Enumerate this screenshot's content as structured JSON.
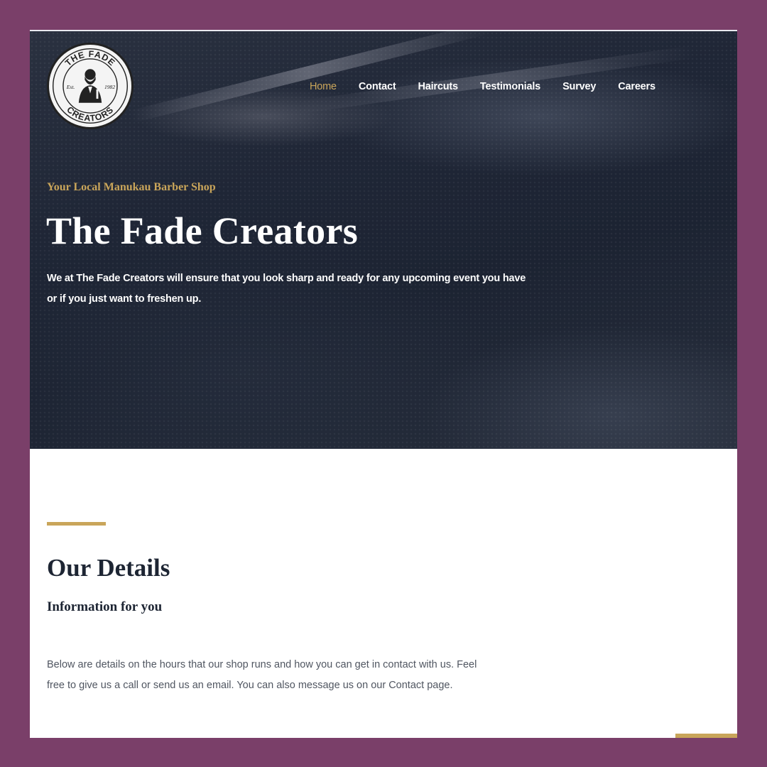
{
  "brand": {
    "logo_top_text": "THE FADE",
    "logo_bottom_text": "CREATORS",
    "logo_left_text": "Est.",
    "logo_right_text": "1982"
  },
  "nav": {
    "items": [
      {
        "label": "Home",
        "active": true
      },
      {
        "label": "Contact",
        "active": false
      },
      {
        "label": "Haircuts",
        "active": false
      },
      {
        "label": "Testimonials",
        "active": false
      },
      {
        "label": "Survey",
        "active": false
      },
      {
        "label": "Careers",
        "active": false
      }
    ]
  },
  "hero": {
    "tagline": "Your Local Manukau Barber Shop",
    "title": "The Fade Creators",
    "intro": "We at The Fade Creators will ensure that you look sharp and ready for any upcoming event you have or if you just want to freshen up."
  },
  "details": {
    "title": "Our Details",
    "subtitle": "Information for you",
    "body": "Below are details on the hours that our shop runs and how you can get in contact with us. Feel free to give us a call or send us an email. You can also message us on our Contact page."
  },
  "colors": {
    "frame_background": "#7a3f69",
    "accent_gold": "#c9a55a",
    "heading_navy": "#1d2533",
    "hero_dark": "#1f2636"
  }
}
